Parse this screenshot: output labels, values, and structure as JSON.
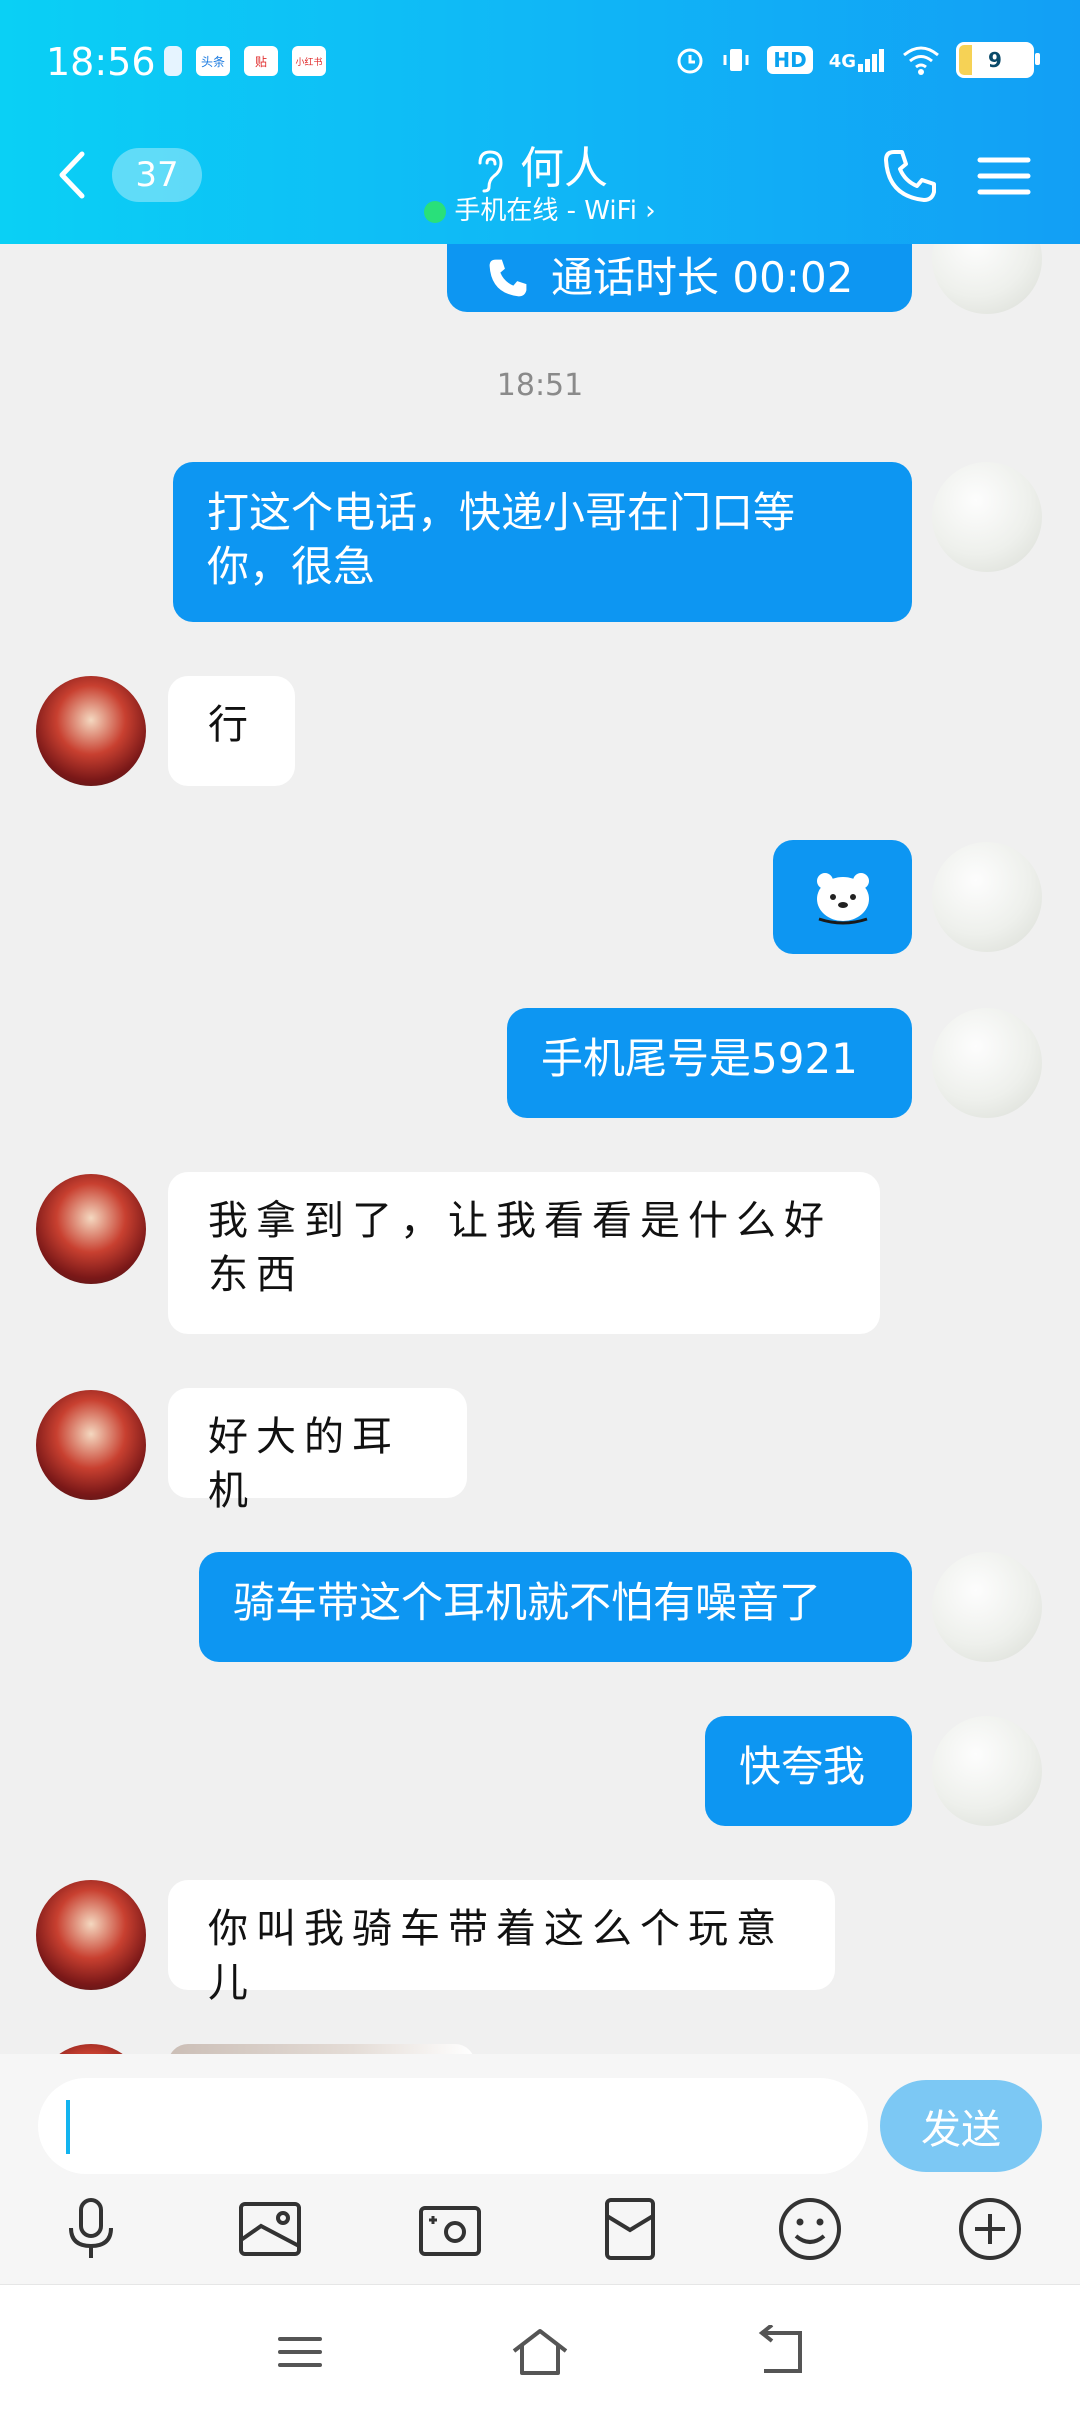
{
  "status_bar": {
    "time": "18:56",
    "app_icons": [
      "头条",
      "贴",
      "小红书"
    ],
    "network": "4G",
    "hd": "HD",
    "battery": "9"
  },
  "header": {
    "unread_count": "37",
    "contact_name": "何人",
    "status": "手机在线 - WiFi ›"
  },
  "messages": {
    "call_record": "通话时长 00:02",
    "time_separator": "18:51",
    "m1": "打这个电话，快递小哥在门口等你，很急",
    "m2": "行",
    "m3_emoji": "bear-sticker",
    "m4": "手机尾号是5921",
    "m5": "我拿到了，让我看看是什么好东西",
    "m6": "好大的耳机",
    "m7": "骑车带这个耳机就不怕有噪音了",
    "m8": "快夸我",
    "m9": "你叫我骑车带着这么个玩意儿"
  },
  "input": {
    "placeholder": "",
    "send_label": "发送"
  },
  "toolbar": [
    "microphone-icon",
    "image-icon",
    "camera-icon",
    "red-packet-icon",
    "emoji-icon",
    "plus-icon"
  ],
  "colors": {
    "header_start": "#0ad0f5",
    "header_end": "#129ff5",
    "my_bubble": "#0d96f2",
    "send_button": "#7cc8f4"
  }
}
